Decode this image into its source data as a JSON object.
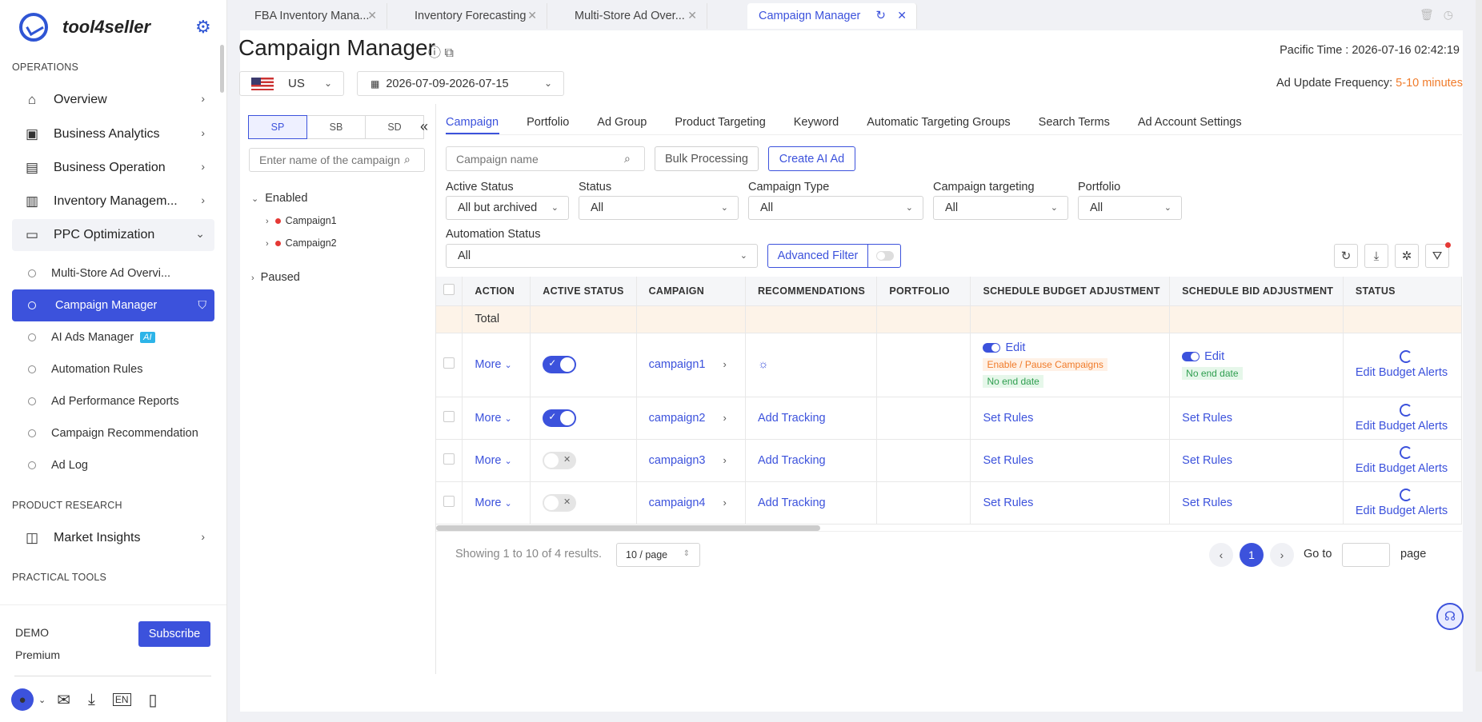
{
  "brand": {
    "name": "tool4seller"
  },
  "sidebar": {
    "sections": {
      "operations": "OPERATIONS",
      "product_research": "PRODUCT RESEARCH",
      "practical_tools": "PRACTICAL TOOLS"
    },
    "items": [
      {
        "label": "Overview",
        "icon": "home-icon"
      },
      {
        "label": "Business Analytics",
        "icon": "chart-icon"
      },
      {
        "label": "Business Operation",
        "icon": "box-icon"
      },
      {
        "label": "Inventory Managem...",
        "icon": "warehouse-icon"
      },
      {
        "label": "PPC Optimization",
        "icon": "monitor-icon"
      }
    ],
    "sub_items": [
      "Multi-Store Ad Overvi...",
      "Campaign Manager",
      "AI Ads Manager",
      "Automation Rules",
      "Ad Performance Reports",
      "Campaign Recommendation",
      "Ad Log"
    ],
    "ai_badge": "AI",
    "market_insights": "Market Insights",
    "account": {
      "name": "DEMO",
      "plan": "Premium",
      "subscribe": "Subscribe"
    }
  },
  "tabs": [
    {
      "label": "FBA Inventory Mana..."
    },
    {
      "label": "Inventory Forecasting"
    },
    {
      "label": "Multi-Store Ad Over..."
    },
    {
      "label": "Campaign Manager",
      "active": true
    }
  ],
  "header": {
    "title": "Campaign Manager",
    "pacific_time": "Pacific Time :  2026-07-16 02:42:19",
    "region": "US",
    "date_range": "2026-07-09-2026-07-15",
    "ad_update_label": "Ad Update Frequency: ",
    "ad_update_value": "5-10 minutes"
  },
  "tree": {
    "segments": [
      "SP",
      "SB",
      "SD"
    ],
    "search_placeholder": "Enter name of the campaign",
    "enabled": "Enabled",
    "campaigns": [
      "Campaign1",
      "Campaign2"
    ],
    "paused": "Paused"
  },
  "content_tabs": [
    "Campaign",
    "Portfolio",
    "Ad Group",
    "Product Targeting",
    "Keyword",
    "Automatic Targeting Groups",
    "Search Terms",
    "Ad Account Settings"
  ],
  "toolbar": {
    "campaign_placeholder": "Campaign name",
    "bulk": "Bulk Processing",
    "create_ai": "Create AI Ad",
    "advanced_filter": "Advanced Filter"
  },
  "filters": {
    "active_status": {
      "label": "Active Status",
      "value": "All but archived"
    },
    "status": {
      "label": "Status",
      "value": "All"
    },
    "campaign_type": {
      "label": "Campaign Type",
      "value": "All"
    },
    "campaign_targeting": {
      "label": "Campaign targeting",
      "value": "All"
    },
    "portfolio": {
      "label": "Portfolio",
      "value": "All"
    },
    "automation_status": {
      "label": "Automation Status",
      "value": "All"
    }
  },
  "table": {
    "headers": [
      "ACTION",
      "ACTIVE STATUS",
      "CAMPAIGN",
      "RECOMMENDATIONS",
      "PORTFOLIO",
      "SCHEDULE BUDGET ADJUSTMENT",
      "SCHEDULE BID ADJUSTMENT",
      "STATUS"
    ],
    "total_label": "Total",
    "more": "More",
    "edit": "Edit",
    "enable_pause": "Enable / Pause Campaigns",
    "no_end_date": "No end date",
    "add_tracking": "Add Tracking",
    "set_rules": "Set Rules",
    "edit_budget_alerts": "Edit Budget Alerts",
    "rows": [
      {
        "campaign": "campaign1",
        "active": true
      },
      {
        "campaign": "campaign2",
        "active": true
      },
      {
        "campaign": "campaign3",
        "active": false
      },
      {
        "campaign": "campaign4",
        "active": false
      }
    ]
  },
  "pagination": {
    "showing": "Showing 1 to 10 of 4 results.",
    "page_size": "10 / page",
    "current_page": "1",
    "goto": "Go to",
    "page": "page"
  },
  "colors": {
    "accent": "#3c52dc",
    "orange": "#f07b2a",
    "green": "#2e9e4f"
  }
}
